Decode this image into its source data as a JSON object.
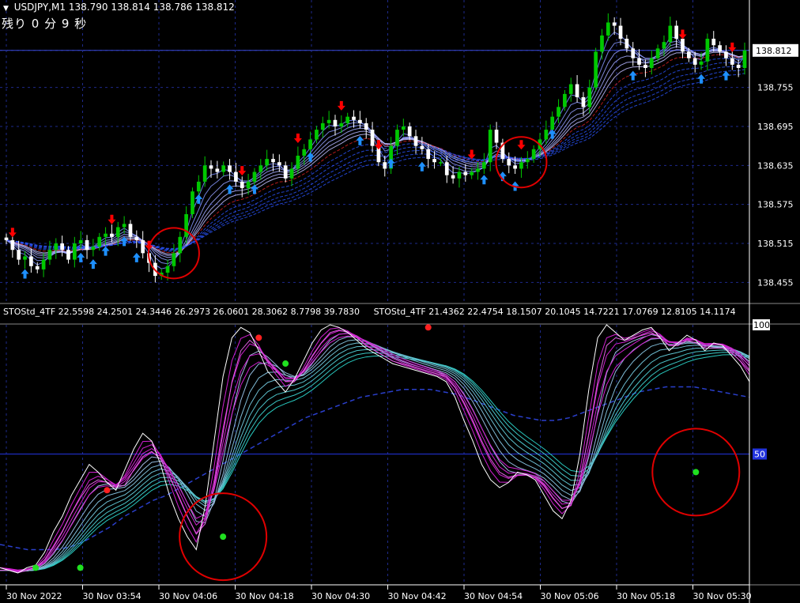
{
  "header": {
    "symbol_tf": "USDJPY,M1",
    "ohlc": "138.790 138.814 138.786 138.812",
    "timer": "残り 0 分 9 秒"
  },
  "sub_header": {
    "ind1": "STOStd_4TF 22.5598 24.2501 24.3446 26.2973 26.0601 28.3062 8.7798 39.7830",
    "ind2": "STOStd_4TF 21.4362 22.4754 18.1507 20.1045 14.7221 17.0769 12.8105 14.1174"
  },
  "colors": {
    "bull": "#00c800",
    "bear": "#ffffff",
    "up_arrow": "#1e90ff",
    "down_arrow": "#ff0000",
    "grid": "#1e2a8c",
    "axis": "#ffffff",
    "circle": "#e00000"
  },
  "chart_data": [
    {
      "type": "candlestick",
      "title": "USDJPY,M1",
      "ylim": [
        138.425,
        138.875
      ],
      "y_ticks": [
        "138.812",
        "138.755",
        "138.695",
        "138.635",
        "138.575",
        "138.515",
        "138.455"
      ],
      "current_price": "138.812",
      "x_labels": [
        "30 Nov 2022",
        "30 Nov 03:54",
        "30 Nov 04:06",
        "30 Nov 04:18",
        "30 Nov 04:30",
        "30 Nov 04:42",
        "30 Nov 04:54",
        "30 Nov 05:06",
        "30 Nov 05:18",
        "30 Nov 05:30"
      ],
      "closes": [
        138.52,
        138.505,
        138.49,
        138.495,
        138.48,
        138.475,
        138.49,
        138.505,
        138.515,
        138.505,
        138.49,
        138.515,
        138.52,
        138.505,
        138.51,
        138.525,
        138.53,
        138.525,
        138.54,
        138.545,
        138.525,
        138.52,
        138.5,
        138.485,
        138.465,
        138.47,
        138.48,
        138.5,
        138.525,
        138.56,
        138.595,
        138.61,
        138.635,
        138.63,
        138.625,
        138.635,
        138.625,
        138.61,
        138.6,
        138.61,
        138.625,
        138.635,
        138.645,
        138.64,
        138.635,
        138.615,
        138.63,
        138.65,
        138.66,
        138.675,
        138.69,
        138.7,
        138.705,
        138.695,
        138.7,
        138.71,
        138.705,
        138.7,
        138.69,
        138.665,
        138.64,
        138.63,
        138.665,
        138.69,
        138.695,
        138.68,
        138.665,
        138.66,
        138.645,
        138.64,
        138.64,
        138.62,
        138.615,
        138.625,
        138.62,
        138.625,
        138.63,
        138.64,
        138.69,
        138.67,
        138.645,
        138.635,
        138.63,
        138.64,
        138.645,
        138.66,
        138.675,
        138.69,
        138.71,
        138.725,
        138.745,
        138.76,
        138.74,
        138.725,
        138.755,
        138.81,
        138.835,
        138.855,
        138.85,
        138.83,
        138.815,
        138.8,
        138.79,
        138.785,
        138.8,
        138.815,
        138.825,
        138.85,
        138.83,
        138.81,
        138.8,
        138.79,
        138.795,
        138.83,
        138.82,
        138.81,
        138.8,
        138.79,
        138.785,
        138.812
      ],
      "up_arrows": [
        3,
        12,
        14,
        16,
        19,
        21,
        31,
        36,
        40,
        49,
        57,
        62,
        67,
        77,
        80,
        82,
        88,
        101,
        112,
        116
      ],
      "down_arrows": [
        1,
        17,
        23,
        38,
        47,
        54,
        60,
        75,
        83,
        109,
        117
      ],
      "highlight_indices": [
        27,
        83
      ]
    },
    {
      "type": "line",
      "title": "STOStd_4TF",
      "ylim": [
        0,
        100
      ],
      "y_ticks": [
        "100",
        "50"
      ],
      "level": 50,
      "fast": [
        6,
        5,
        4,
        6,
        7,
        12,
        20,
        26,
        34,
        40,
        46,
        43,
        39,
        36,
        44,
        52,
        58,
        55,
        46,
        34,
        25,
        18,
        13,
        30,
        55,
        80,
        95,
        99,
        97,
        90,
        82,
        78,
        74,
        79,
        86,
        93,
        98,
        100,
        99,
        97,
        94,
        91,
        89,
        87,
        85,
        84,
        83,
        82,
        81,
        80,
        78,
        72,
        63,
        55,
        46,
        40,
        37,
        39,
        43,
        42,
        40,
        34,
        28,
        25,
        32,
        50,
        75,
        95,
        100,
        97,
        94,
        96,
        98,
        99,
        95,
        90,
        93,
        96,
        94,
        90,
        93,
        92,
        88,
        84,
        78
      ],
      "slow": [
        5,
        5,
        4,
        5,
        6,
        9,
        14,
        20,
        27,
        33,
        38,
        40,
        39,
        37,
        38,
        44,
        49,
        51,
        48,
        41,
        34,
        26,
        19,
        23,
        38,
        58,
        78,
        90,
        94,
        91,
        86,
        82,
        78,
        78,
        82,
        88,
        93,
        97,
        98,
        97,
        95,
        92,
        90,
        88,
        86,
        85,
        84,
        83,
        82,
        81,
        80,
        76,
        70,
        63,
        55,
        48,
        43,
        41,
        42,
        42,
        41,
        38,
        33,
        29,
        30,
        40,
        58,
        78,
        92,
        95,
        94,
        95,
        96,
        97,
        95,
        92,
        92,
        94,
        93,
        91,
        91,
        91,
        89,
        86,
        82
      ],
      "trend": [
        15,
        14,
        13,
        13,
        13,
        14,
        16,
        19,
        22,
        26,
        29,
        32,
        34,
        37,
        40,
        43,
        46,
        49,
        52,
        55,
        58,
        61,
        64,
        66,
        68,
        70,
        72,
        73,
        74,
        75,
        75,
        75,
        74,
        73,
        71,
        69,
        67,
        65,
        64,
        63,
        63,
        64,
        66,
        68,
        70,
        72,
        74,
        75,
        76,
        76,
        76,
        75,
        74,
        73,
        72
      ],
      "red_dots": [
        [
          12,
          36
        ],
        [
          29,
          95
        ],
        [
          48,
          99
        ],
        [
          94,
          97
        ],
        [
          105,
          90
        ]
      ],
      "green_dots": [
        [
          4,
          6
        ],
        [
          9,
          6
        ],
        [
          32,
          85
        ],
        [
          78,
          43
        ],
        [
          25,
          18
        ]
      ],
      "highlight_points": [
        [
          25,
          18
        ],
        [
          78,
          43
        ]
      ]
    }
  ]
}
